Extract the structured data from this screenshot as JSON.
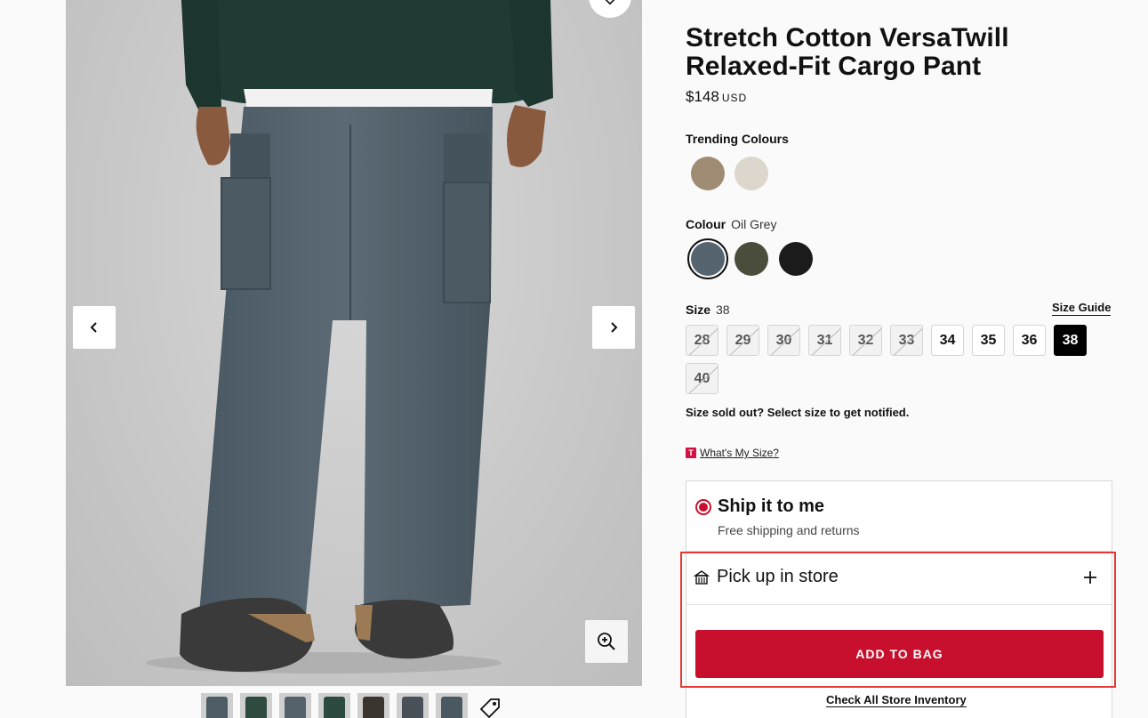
{
  "product": {
    "title": "Stretch Cotton VersaTwill Relaxed-Fit Cargo Pant",
    "price": "$148",
    "currency": "USD"
  },
  "gallery": {
    "thumbnails": [
      {
        "color": "#4e5c66"
      },
      {
        "color": "#2f4a3f"
      },
      {
        "color": "#55626b"
      },
      {
        "color": "#2d4a40"
      },
      {
        "color": "#3b3530"
      },
      {
        "color": "#4a5058"
      },
      {
        "color": "#4a5862"
      }
    ]
  },
  "trending": {
    "label": "Trending Colours",
    "swatches": [
      {
        "name": "tan-swatch",
        "color": "#a08c74"
      },
      {
        "name": "bone-swatch",
        "color": "#ddd6cc"
      }
    ]
  },
  "colour": {
    "label": "Colour",
    "selected": "Oil Grey",
    "swatches": [
      {
        "name": "oil-grey",
        "color": "#56646f"
      },
      {
        "name": "army-green",
        "color": "#4a4c3c"
      },
      {
        "name": "black",
        "color": "#1b1b1b"
      }
    ]
  },
  "size": {
    "label": "Size",
    "selected": "38",
    "guide": "Size Guide",
    "options": [
      {
        "label": "28",
        "available": false
      },
      {
        "label": "29",
        "available": false
      },
      {
        "label": "30",
        "available": false
      },
      {
        "label": "31",
        "available": false
      },
      {
        "label": "32",
        "available": false
      },
      {
        "label": "33",
        "available": false
      },
      {
        "label": "34",
        "available": true
      },
      {
        "label": "35",
        "available": true
      },
      {
        "label": "36",
        "available": true
      },
      {
        "label": "38",
        "available": true,
        "selected": true
      },
      {
        "label": "40",
        "available": false
      }
    ],
    "soldout_note": "Size sold out? Select size to get notified.",
    "whats_my_size": "What's My Size?",
    "whats_my_size_badge": "T"
  },
  "fulfillment": {
    "ship_title": "Ship it to me",
    "ship_sub": "Free shipping and returns",
    "pickup_label": "Pick up in store",
    "add_to_bag": "ADD TO BAG",
    "check_inventory": "Check All Store Inventory"
  },
  "colors": {
    "accent": "#c8102e",
    "highlight": "#e53935"
  }
}
